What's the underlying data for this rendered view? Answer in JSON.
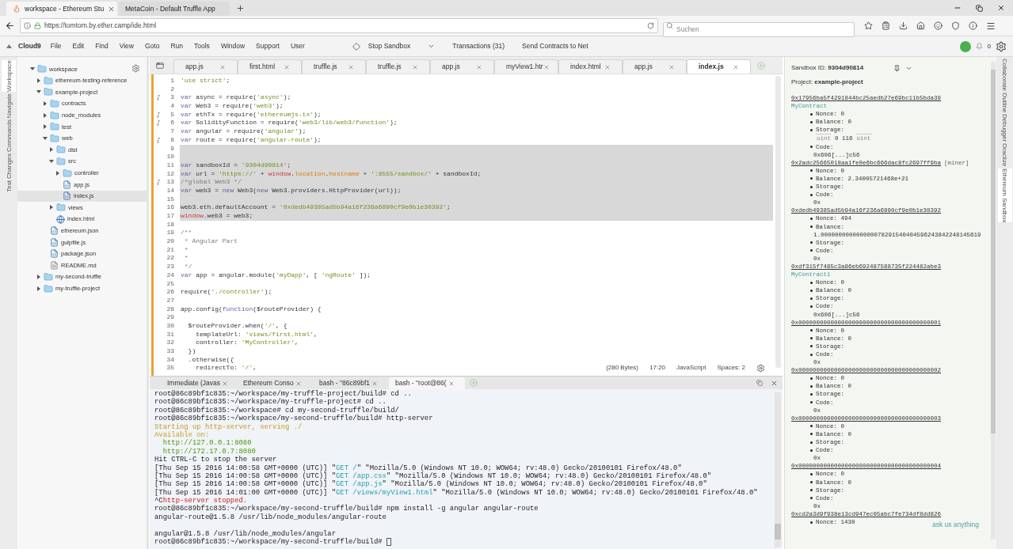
{
  "browser": {
    "tabs": [
      {
        "title": "workspace - Ethereum Stu",
        "selected": true
      },
      {
        "title": "MetaCoin - Default Truffle App",
        "selected": false
      }
    ],
    "url": "https://tomtom.by.ether.camp/ide.html",
    "search": {
      "placeholder": "Suchen"
    }
  },
  "menu": {
    "brand": "Cloud9",
    "items": [
      "File",
      "Edit",
      "Find",
      "View",
      "Goto",
      "Run",
      "Tools",
      "Window",
      "Support",
      "User"
    ],
    "actions": [
      {
        "label": "Stop Sandbox",
        "kind": "dropdown"
      },
      {
        "label": "Transactions (31)",
        "kind": "button"
      },
      {
        "label": "Send Contracts to Net",
        "kind": "button"
      }
    ],
    "notification_count": "0"
  },
  "left_tabs": [
    {
      "label": "Workspace",
      "selected": true
    },
    {
      "label": "Navigate",
      "selected": false
    },
    {
      "label": "Commands",
      "selected": false
    },
    {
      "label": "Changes",
      "selected": false
    },
    {
      "label": "Test",
      "selected": false
    }
  ],
  "file_tree": [
    {
      "name": "workspace",
      "kind": "folder",
      "expanded": true,
      "selected": false,
      "children": [
        {
          "name": "ethereum-testing-reference",
          "kind": "folder",
          "expanded": false,
          "selected": false
        },
        {
          "name": "example-project",
          "kind": "folder",
          "expanded": true,
          "selected": false,
          "children": [
            {
              "name": "contracts",
              "kind": "folder",
              "expanded": false,
              "selected": false
            },
            {
              "name": "node_modules",
              "kind": "folder",
              "expanded": false,
              "selected": false
            },
            {
              "name": "test",
              "kind": "folder",
              "expanded": false,
              "selected": false
            },
            {
              "name": "web",
              "kind": "folder",
              "expanded": true,
              "selected": false,
              "children": [
                {
                  "name": "dist",
                  "kind": "folder",
                  "expanded": false,
                  "selected": false
                },
                {
                  "name": "src",
                  "kind": "folder",
                  "expanded": true,
                  "selected": false,
                  "children": [
                    {
                      "name": "controller",
                      "kind": "folder",
                      "expanded": false,
                      "selected": false
                    },
                    {
                      "name": "app.js",
                      "kind": "code",
                      "selected": false
                    },
                    {
                      "name": "index.js",
                      "kind": "code",
                      "selected": true
                    }
                  ]
                },
                {
                  "name": "views",
                  "kind": "folder",
                  "expanded": false,
                  "selected": false
                },
                {
                  "name": "index.html",
                  "kind": "html",
                  "selected": false
                }
              ]
            },
            {
              "name": "ethereum.json",
              "kind": "code",
              "selected": false
            },
            {
              "name": "gulpfile.js",
              "kind": "code",
              "selected": false
            },
            {
              "name": "package.json",
              "kind": "code",
              "selected": false
            },
            {
              "name": "README.md",
              "kind": "doc",
              "selected": false
            }
          ]
        },
        {
          "name": "my-second-truffle",
          "kind": "folder",
          "expanded": false,
          "selected": false
        },
        {
          "name": "my-truffle-project",
          "kind": "folder",
          "expanded": false,
          "selected": false
        }
      ]
    }
  ],
  "editor": {
    "tabs": [
      {
        "label": "app.js",
        "selected": false
      },
      {
        "label": "first.html",
        "selected": false
      },
      {
        "label": "truffle.js",
        "selected": false
      },
      {
        "label": "truffle.js",
        "selected": false
      },
      {
        "label": "app.js",
        "selected": false
      },
      {
        "label": "myView1.htr",
        "selected": false
      },
      {
        "label": "index.html",
        "selected": false
      },
      {
        "label": "app.js",
        "selected": false
      },
      {
        "label": "index.js",
        "selected": true
      }
    ],
    "lines": [
      {
        "number": "1",
        "hint": false,
        "selected": false,
        "tokens": [
          {
            "kind": "string",
            "text": "'use strict'"
          },
          {
            "kind": "plain",
            "text": ";"
          }
        ]
      },
      {
        "number": "2",
        "hint": false,
        "selected": false
      },
      {
        "number": "3",
        "hint": true,
        "selected": false,
        "tokens": [
          {
            "kind": "keyword",
            "text": "var"
          },
          {
            "kind": "plain",
            "text": " async = require("
          },
          {
            "kind": "string",
            "text": "'async'"
          },
          {
            "kind": "plain",
            "text": ");"
          }
        ]
      },
      {
        "number": "4",
        "hint": false,
        "selected": false,
        "tokens": [
          {
            "kind": "keyword",
            "text": "var"
          },
          {
            "kind": "plain",
            "text": " Web3 = require("
          },
          {
            "kind": "string",
            "text": "'web3'"
          },
          {
            "kind": "plain",
            "text": ");"
          }
        ]
      },
      {
        "number": "5",
        "hint": true,
        "selected": false,
        "tokens": [
          {
            "kind": "keyword",
            "text": "var"
          },
          {
            "kind": "plain",
            "text": " ethTx = require("
          },
          {
            "kind": "string",
            "text": "'ethereumjs-tx'"
          },
          {
            "kind": "plain",
            "text": ");"
          }
        ]
      },
      {
        "number": "6",
        "hint": true,
        "selected": false,
        "tokens": [
          {
            "kind": "keyword",
            "text": "var"
          },
          {
            "kind": "plain",
            "text": " SolidityFunction = require("
          },
          {
            "kind": "string",
            "text": "'web3/lib/web3/function'"
          },
          {
            "kind": "plain",
            "text": ");"
          }
        ]
      },
      {
        "number": "7",
        "hint": false,
        "selected": false,
        "tokens": [
          {
            "kind": "keyword",
            "text": "var"
          },
          {
            "kind": "plain",
            "text": " angular = require("
          },
          {
            "kind": "string",
            "text": "'angular'"
          },
          {
            "kind": "plain",
            "text": ");"
          }
        ]
      },
      {
        "number": "8",
        "hint": true,
        "selected": false,
        "tokens": [
          {
            "kind": "keyword",
            "text": "var"
          },
          {
            "kind": "plain",
            "text": " route = require("
          },
          {
            "kind": "string",
            "text": "'angular-route'"
          },
          {
            "kind": "plain",
            "text": ");"
          }
        ]
      },
      {
        "number": "9",
        "hint": false,
        "selected": true
      },
      {
        "number": "10",
        "hint": false,
        "selected": true
      },
      {
        "number": "11",
        "hint": false,
        "selected": true,
        "tokens": [
          {
            "kind": "keyword",
            "text": "var"
          },
          {
            "kind": "plain",
            "text": " sandboxId = "
          },
          {
            "kind": "string",
            "text": "'9304d90814'"
          },
          {
            "kind": "plain",
            "text": ";"
          }
        ]
      },
      {
        "number": "12",
        "hint": false,
        "selected": true,
        "tokens": [
          {
            "kind": "keyword",
            "text": "var"
          },
          {
            "kind": "plain",
            "text": " url = "
          },
          {
            "kind": "string",
            "text": "'https://'"
          },
          {
            "kind": "plain",
            "text": " + "
          },
          {
            "kind": "global",
            "text": "window"
          },
          {
            "kind": "plain",
            "text": "."
          },
          {
            "kind": "prop",
            "text": "location"
          },
          {
            "kind": "plain",
            "text": "."
          },
          {
            "kind": "prop",
            "text": "hostname"
          },
          {
            "kind": "plain",
            "text": " + "
          },
          {
            "kind": "string",
            "text": "':8555/sandbox/'"
          },
          {
            "kind": "plain",
            "text": " + sandboxId;"
          }
        ]
      },
      {
        "number": "13",
        "hint": true,
        "selected": true,
        "tokens": [
          {
            "kind": "comment",
            "text": "/*global Web3 */"
          }
        ]
      },
      {
        "number": "14",
        "hint": false,
        "selected": true,
        "tokens": [
          {
            "kind": "keyword",
            "text": "var"
          },
          {
            "kind": "plain",
            "text": " web3 = "
          },
          {
            "kind": "keyword",
            "text": "new"
          },
          {
            "kind": "plain",
            "text": " Web3("
          },
          {
            "kind": "keyword",
            "text": "new"
          },
          {
            "kind": "plain",
            "text": " Web3.providers.HttpProvider(url));"
          }
        ]
      },
      {
        "number": "15",
        "hint": false,
        "selected": true
      },
      {
        "number": "16",
        "hint": false,
        "selected": true,
        "tokens": [
          {
            "kind": "plain",
            "text": "web3.eth.defaultAccount = "
          },
          {
            "kind": "string",
            "text": "'0xdedb49385ad5b94a16f236a6890cf9e0b1e30392'"
          },
          {
            "kind": "plain",
            "text": ";"
          }
        ]
      },
      {
        "number": "17",
        "hint": false,
        "selected": true,
        "tokens": [
          {
            "kind": "global",
            "text": "window"
          },
          {
            "kind": "plain",
            "text": ".web3 = web3;"
          }
        ]
      },
      {
        "number": "18",
        "hint": false,
        "selected": false
      },
      {
        "number": "19",
        "hint": false,
        "selected": false,
        "tokens": [
          {
            "kind": "comment",
            "text": "/**"
          }
        ]
      },
      {
        "number": "20",
        "hint": false,
        "selected": false,
        "tokens": [
          {
            "kind": "comment",
            "text": " * Angular Part"
          }
        ]
      },
      {
        "number": "21",
        "hint": false,
        "selected": false,
        "tokens": [
          {
            "kind": "comment",
            "text": " *"
          }
        ]
      },
      {
        "number": "22",
        "hint": false,
        "selected": false,
        "tokens": [
          {
            "kind": "comment",
            "text": " *"
          }
        ]
      },
      {
        "number": "23",
        "hint": false,
        "selected": false,
        "tokens": [
          {
            "kind": "comment",
            "text": " */"
          }
        ]
      },
      {
        "number": "24",
        "hint": false,
        "selected": false,
        "tokens": [
          {
            "kind": "keyword",
            "text": "var"
          },
          {
            "kind": "plain",
            "text": " app = angular.module("
          },
          {
            "kind": "string",
            "text": "'myDapp'"
          },
          {
            "kind": "plain",
            "text": ", [ "
          },
          {
            "kind": "string",
            "text": "'ngRoute'"
          },
          {
            "kind": "plain",
            "text": " ]);"
          }
        ]
      },
      {
        "number": "25",
        "hint": false,
        "selected": false
      },
      {
        "number": "26",
        "hint": false,
        "selected": false,
        "tokens": [
          {
            "kind": "plain",
            "text": "require("
          },
          {
            "kind": "string",
            "text": "'./controller'"
          },
          {
            "kind": "plain",
            "text": ");"
          }
        ]
      },
      {
        "number": "27",
        "hint": false,
        "selected": false
      },
      {
        "number": "28",
        "hint": false,
        "selected": false,
        "tokens": [
          {
            "kind": "plain",
            "text": "app.config("
          },
          {
            "kind": "keyword",
            "text": "function"
          },
          {
            "kind": "plain",
            "text": "($routeProvider) {"
          }
        ]
      },
      {
        "number": "29",
        "hint": false,
        "selected": false
      },
      {
        "number": "30",
        "hint": false,
        "selected": false,
        "tokens": [
          {
            "kind": "plain",
            "text": "  $routeProvider.when("
          },
          {
            "kind": "string",
            "text": "'/'"
          },
          {
            "kind": "plain",
            "text": ", {"
          }
        ]
      },
      {
        "number": "31",
        "hint": false,
        "selected": false,
        "tokens": [
          {
            "kind": "plain",
            "text": "    templateUrl: "
          },
          {
            "kind": "string",
            "text": "'views/first.html'"
          },
          {
            "kind": "plain",
            "text": ","
          }
        ]
      },
      {
        "number": "32",
        "hint": false,
        "selected": false,
        "tokens": [
          {
            "kind": "plain",
            "text": "    controller: "
          },
          {
            "kind": "string",
            "text": "'MyController'"
          },
          {
            "kind": "plain",
            "text": ","
          }
        ]
      },
      {
        "number": "33",
        "hint": false,
        "selected": false,
        "tokens": [
          {
            "kind": "plain",
            "text": "  })"
          }
        ]
      },
      {
        "number": "34",
        "hint": false,
        "selected": false,
        "tokens": [
          {
            "kind": "plain",
            "text": "  .otherwise({"
          }
        ]
      },
      {
        "number": "35",
        "hint": false,
        "selected": false,
        "tokens": [
          {
            "kind": "plain",
            "text": "    redirectTo: "
          },
          {
            "kind": "string",
            "text": "'/'"
          },
          {
            "kind": "plain",
            "text": ","
          }
        ]
      }
    ],
    "status": {
      "size": "(280 Bytes)",
      "cursor": "17:20",
      "language": "JavaScript",
      "indent": "Spaces: 2"
    }
  },
  "terminal": {
    "tabs": [
      {
        "label": "Immediate (Javas",
        "selected": false
      },
      {
        "label": "Ethereum Conso",
        "selected": false
      },
      {
        "label": "bash - \"86c89bf1",
        "selected": false
      },
      {
        "label": "bash - \"root@86(",
        "selected": true
      }
    ],
    "lines": [
      {
        "kind": "text",
        "segments": [
          {
            "kind": "plain",
            "text": "root@86c89bf1c835:~/workspace/my-truffle-project/build# cd .."
          }
        ]
      },
      {
        "kind": "text",
        "segments": [
          {
            "kind": "plain",
            "text": "root@86c89bf1c835:~/workspace/my-truffle-project# cd .."
          }
        ]
      },
      {
        "kind": "text",
        "segments": [
          {
            "kind": "plain",
            "text": "root@86c89bf1c835:~/workspace# cd my-second-truffle/build/"
          }
        ]
      },
      {
        "kind": "text",
        "segments": [
          {
            "kind": "plain",
            "text": "root@86c89bf1c835:~/workspace/my-second-truffle/build# http-server"
          }
        ]
      },
      {
        "kind": "text",
        "segments": [
          {
            "kind": "yellow",
            "text": "Starting up http-server, serving ./"
          }
        ]
      },
      {
        "kind": "text",
        "segments": [
          {
            "kind": "yellow",
            "text": "Available on:"
          }
        ]
      },
      {
        "kind": "text",
        "segments": [
          {
            "kind": "green",
            "text": "  http://127.0.0.1:8080"
          }
        ]
      },
      {
        "kind": "text",
        "segments": [
          {
            "kind": "green",
            "text": "  http://172.17.0.7:8080"
          }
        ]
      },
      {
        "kind": "text",
        "segments": [
          {
            "kind": "plain",
            "text": "Hit CTRL-C to stop the server"
          }
        ]
      },
      {
        "kind": "text",
        "segments": [
          {
            "kind": "plain",
            "text": "[Thu Sep 15 2016 14:00:58 GMT+0000 (UTC)] \""
          },
          {
            "kind": "cyan",
            "text": "GET /"
          },
          {
            "kind": "plain",
            "text": "\" \"Mozilla/5.0 (Windows NT 10.0; WOW64; rv:48.0) Gecko/20100101 Firefox/48.0\""
          }
        ]
      },
      {
        "kind": "text",
        "segments": [
          {
            "kind": "plain",
            "text": "[Thu Sep 15 2016 14:00:58 GMT+0000 (UTC)] \""
          },
          {
            "kind": "cyan",
            "text": "GET /app.css"
          },
          {
            "kind": "plain",
            "text": "\" \"Mozilla/5.0 (Windows NT 10.0; WOW64; rv:48.0) Gecko/20100101 Firefox/48.0\""
          }
        ]
      },
      {
        "kind": "text",
        "segments": [
          {
            "kind": "plain",
            "text": "[Thu Sep 15 2016 14:00:58 GMT+0000 (UTC)] \""
          },
          {
            "kind": "cyan",
            "text": "GET /app.js"
          },
          {
            "kind": "plain",
            "text": "\" \"Mozilla/5.0 (Windows NT 10.0; WOW64; rv:48.0) Gecko/20100101 Firefox/48.0\""
          }
        ]
      },
      {
        "kind": "text",
        "segments": [
          {
            "kind": "plain",
            "text": "[Thu Sep 15 2016 14:01:00 GMT+0000 (UTC)] \""
          },
          {
            "kind": "cyan",
            "text": "GET /views/myView1.html"
          },
          {
            "kind": "plain",
            "text": "\" \"Mozilla/5.0 (Windows NT 10.0; WOW64; rv:48.0) Gecko/20100101 Firefox/48.0\""
          }
        ]
      },
      {
        "kind": "text",
        "segments": [
          {
            "kind": "plain",
            "text": "^C"
          },
          {
            "kind": "red",
            "text": "http-server stopped."
          }
        ]
      },
      {
        "kind": "text",
        "segments": [
          {
            "kind": "plain",
            "text": "root@86c89bf1c835:~/workspace/my-second-truffle/build# npm install -g angular angular-route"
          }
        ]
      },
      {
        "kind": "text",
        "segments": [
          {
            "kind": "plain",
            "text": "angular-route@1.5.8 /usr/lib/node_modules/angular-route"
          }
        ]
      },
      {
        "kind": "blank"
      },
      {
        "kind": "text",
        "segments": [
          {
            "kind": "plain",
            "text": "angular@1.5.8 /usr/lib/node_modules/angular"
          }
        ]
      },
      {
        "kind": "text",
        "cursor": true,
        "segments": [
          {
            "kind": "plain",
            "text": "root@86c89bf1c835:~/workspace/my-second-truffle/build# "
          }
        ]
      }
    ]
  },
  "sandbox": {
    "id_line": "Sandbox ID: **9304d90814**",
    "project_line": "Project: **example-project**",
    "help_link": "ask us anything",
    "accounts": [
      {
        "address": "0x17956ba5f4291844bc25aedb27e69bc11b5bda39",
        "contract": "MyContract",
        "fields": [
          {
            "kind": "inline",
            "label": "Nonce:",
            "value": "0"
          },
          {
            "kind": "inline",
            "label": "Balance:",
            "value": "0"
          },
          {
            "kind": "storage",
            "label": "Storage:",
            "entries": [
              {
                "kind": "type",
                "text": "uint"
              },
              {
                "kind": "value",
                "text": "0 116"
              },
              {
                "kind": "type",
                "text": "uint"
              }
            ]
          },
          {
            "kind": "below",
            "label": "Code:",
            "value": "0x606[...]c56"
          }
        ]
      },
      {
        "address": "0x2adc25665018aa1fe0e6bc666dac8fc2697ff9ba",
        "tag": "[miner]",
        "fields": [
          {
            "kind": "inline",
            "label": "Nonce:",
            "value": "0"
          },
          {
            "kind": "inline",
            "label": "Balance:",
            "value": "2.34005721468e+21"
          },
          {
            "kind": "inline",
            "label": "Storage:"
          },
          {
            "kind": "below",
            "label": "Code:",
            "value": "0x"
          }
        ]
      },
      {
        "address": "0xdedb49385ad5b94a16f236a6890cf9e0b1e30392",
        "fields": [
          {
            "kind": "inline",
            "label": "Nonce:",
            "value": "494"
          },
          {
            "kind": "below",
            "label": "Balance:",
            "value": "1.000000000000000078291540404596243842248145619"
          },
          {
            "kind": "inline",
            "label": "Storage:"
          },
          {
            "kind": "below",
            "label": "Code:",
            "value": "0x"
          }
        ]
      },
      {
        "address": "0xdf315f7485c3a86eb692487588735f224482abe3",
        "contract": "MyContract1",
        "fields": [
          {
            "kind": "inline",
            "label": "Nonce:",
            "value": "0"
          },
          {
            "kind": "inline",
            "label": "Balance:",
            "value": "0"
          },
          {
            "kind": "inline",
            "label": "Storage:"
          },
          {
            "kind": "below",
            "label": "Code:",
            "value": "0x606[...]c56"
          }
        ]
      },
      {
        "address": "0x0000000000000000000000000000000000000001",
        "fields": [
          {
            "kind": "inline",
            "label": "Nonce:",
            "value": "0"
          },
          {
            "kind": "inline",
            "label": "Balance:",
            "value": "0"
          },
          {
            "kind": "inline",
            "label": "Storage:"
          },
          {
            "kind": "below",
            "label": "Code:",
            "value": "0x"
          }
        ]
      },
      {
        "address": "0x0000000000000000000000000000000000000002",
        "fields": [
          {
            "kind": "inline",
            "label": "Nonce:",
            "value": "0"
          },
          {
            "kind": "inline",
            "label": "Balance:",
            "value": "0"
          },
          {
            "kind": "inline",
            "label": "Storage:"
          },
          {
            "kind": "below",
            "label": "Code:",
            "value": "0x"
          }
        ]
      },
      {
        "address": "0x0000000000000000000000000000000000000003",
        "fields": [
          {
            "kind": "inline",
            "label": "Nonce:",
            "value": "0"
          },
          {
            "kind": "inline",
            "label": "Balance:",
            "value": "0"
          },
          {
            "kind": "inline",
            "label": "Storage:"
          },
          {
            "kind": "below",
            "label": "Code:",
            "value": "0x"
          }
        ]
      },
      {
        "address": "0x0000000000000000000000000000000000000004",
        "fields": [
          {
            "kind": "inline",
            "label": "Nonce:",
            "value": "0"
          },
          {
            "kind": "inline",
            "label": "Balance:",
            "value": "0"
          },
          {
            "kind": "inline",
            "label": "Storage:"
          },
          {
            "kind": "below",
            "label": "Code:",
            "value": "0x"
          }
        ]
      },
      {
        "address": "0xcd2a3d9f938e13cd947ec05abc7fe734df8dd826",
        "fields": [
          {
            "kind": "inline",
            "label": "Nonce:",
            "value": "1430"
          }
        ]
      }
    ]
  },
  "right_tabs": [
    {
      "label": "Collaborate",
      "selected": false
    },
    {
      "label": "Outline",
      "selected": false
    },
    {
      "label": "Debugger",
      "selected": false
    },
    {
      "label": "Oraclize",
      "selected": false
    },
    {
      "label": "Ethereum Sandbox",
      "selected": true
    }
  ]
}
